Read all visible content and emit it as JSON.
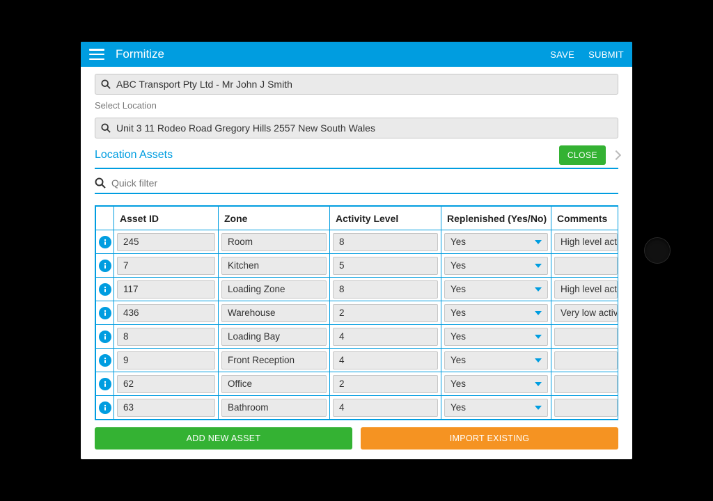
{
  "appbar": {
    "title": "Formitize",
    "actions": {
      "save": "SAVE",
      "submit": "SUBMIT"
    }
  },
  "customer_field": {
    "value": "ABC Transport Pty Ltd - Mr John J Smith"
  },
  "location": {
    "label": "Select Location",
    "value": "Unit 3 11 Rodeo Road Gregory Hills 2557 New South Wales"
  },
  "section": {
    "title": "Location Assets",
    "close": "CLOSE"
  },
  "filter": {
    "placeholder": "Quick filter"
  },
  "table": {
    "headers": {
      "asset_id": "Asset ID",
      "zone": "Zone",
      "activity": "Activity Level",
      "replenished": "Replenished (Yes/No)",
      "comments": "Comments"
    },
    "rows": [
      {
        "asset_id": "245",
        "zone": "Room",
        "activity": "8",
        "replenished": "Yes",
        "comments": "High level activ"
      },
      {
        "asset_id": "7",
        "zone": "Kitchen",
        "activity": "5",
        "replenished": "Yes",
        "comments": ""
      },
      {
        "asset_id": "117",
        "zone": "Loading Zone",
        "activity": "8",
        "replenished": "Yes",
        "comments": "High level activ"
      },
      {
        "asset_id": "436",
        "zone": "Warehouse",
        "activity": "2",
        "replenished": "Yes",
        "comments": "Very low activity"
      },
      {
        "asset_id": "8",
        "zone": "Loading Bay",
        "activity": "4",
        "replenished": "Yes",
        "comments": ""
      },
      {
        "asset_id": "9",
        "zone": "Front Reception",
        "activity": "4",
        "replenished": "Yes",
        "comments": ""
      },
      {
        "asset_id": "62",
        "zone": "Office",
        "activity": "2",
        "replenished": "Yes",
        "comments": ""
      },
      {
        "asset_id": "63",
        "zone": "Bathroom",
        "activity": "4",
        "replenished": "Yes",
        "comments": ""
      }
    ]
  },
  "buttons": {
    "add": "ADD NEW ASSET",
    "import": "IMPORT EXISTING"
  },
  "colors": {
    "brand": "#009de0",
    "green": "#34b233",
    "orange": "#f59322"
  }
}
